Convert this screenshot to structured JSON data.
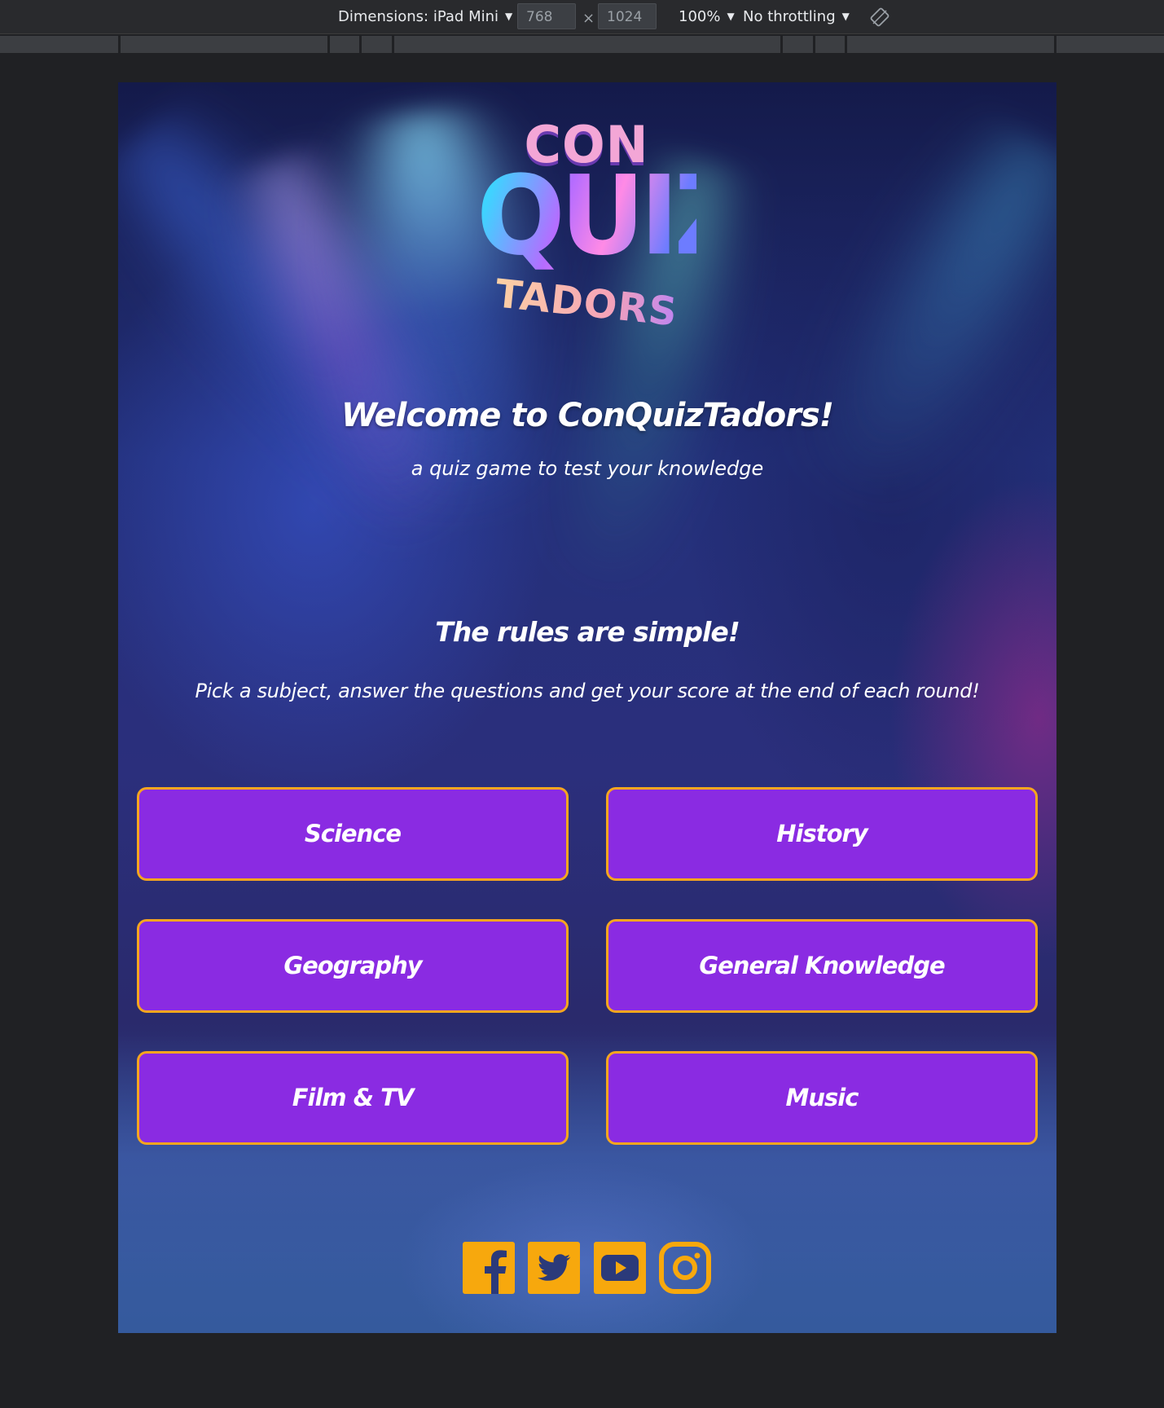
{
  "devtools": {
    "device_label": "Dimensions: iPad Mini",
    "width_value": "768",
    "times": "×",
    "height_value": "1024",
    "zoom": "100%",
    "throttling": "No throttling",
    "rotate_icon": "rotate-icon"
  },
  "page": {
    "logo": {
      "line1": "CON",
      "line2": "QUIZ",
      "line3": "TADORS"
    },
    "title": "Welcome to ConQuizTadors!",
    "tagline": "a quiz game to test your knowledge",
    "rules_heading": "The rules are simple!",
    "rules_text": "Pick a subject, answer the questions and get your score at the end of each round!",
    "categories": [
      {
        "label": "Science"
      },
      {
        "label": "History"
      },
      {
        "label": "Geography"
      },
      {
        "label": "General Knowledge"
      },
      {
        "label": "Film & TV"
      },
      {
        "label": "Music"
      }
    ],
    "social": [
      {
        "icon": "facebook-icon"
      },
      {
        "icon": "twitter-icon"
      },
      {
        "icon": "youtube-icon"
      },
      {
        "icon": "instagram-icon"
      }
    ]
  },
  "colors": {
    "button_fill": "#8a2be2",
    "button_border": "#f6a61e",
    "social_icon": "#f7a80d",
    "devtools_bg": "#292a2d"
  }
}
